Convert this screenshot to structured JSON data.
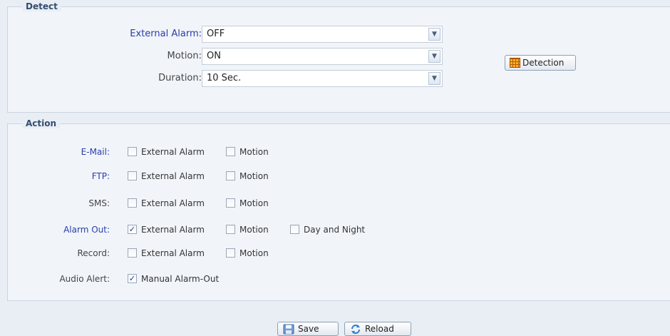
{
  "detect": {
    "legend": "Detect",
    "external_alarm": {
      "label": "External Alarm:",
      "value": "OFF"
    },
    "motion": {
      "label": "Motion:",
      "value": "ON"
    },
    "duration": {
      "label": "Duration:",
      "value": "10 Sec."
    },
    "detection_button": "Detection"
  },
  "action": {
    "legend": "Action",
    "rows": [
      {
        "label": "E-Mail:",
        "options": [
          {
            "text": "External Alarm",
            "checked": false
          },
          {
            "text": "Motion",
            "checked": false
          }
        ]
      },
      {
        "label": "FTP:",
        "options": [
          {
            "text": "External Alarm",
            "checked": false
          },
          {
            "text": "Motion",
            "checked": false
          }
        ]
      },
      {
        "label": "SMS:",
        "options": [
          {
            "text": "External Alarm",
            "checked": false
          },
          {
            "text": "Motion",
            "checked": false
          }
        ]
      },
      {
        "label": "Alarm Out:",
        "options": [
          {
            "text": "External Alarm",
            "checked": true
          },
          {
            "text": "Motion",
            "checked": false
          },
          {
            "text": "Day and Night",
            "checked": false
          }
        ]
      },
      {
        "label": "Record:",
        "options": [
          {
            "text": "External Alarm",
            "checked": false
          },
          {
            "text": "Motion",
            "checked": false
          }
        ]
      },
      {
        "label": "Audio Alert:",
        "options": [
          {
            "text": "Manual Alarm-Out",
            "checked": true
          }
        ]
      }
    ]
  },
  "buttons": {
    "save": "Save",
    "reload": "Reload"
  },
  "icons": {
    "dropdown": "chevron-down-icon",
    "detection": "grid-icon",
    "save": "floppy-disk-icon",
    "reload": "refresh-icon",
    "checked": "check-icon"
  },
  "colors": {
    "blue_label": "#2b3ca8",
    "panel_bg": "#f1f5fa",
    "page_bg": "#e9eef5"
  }
}
